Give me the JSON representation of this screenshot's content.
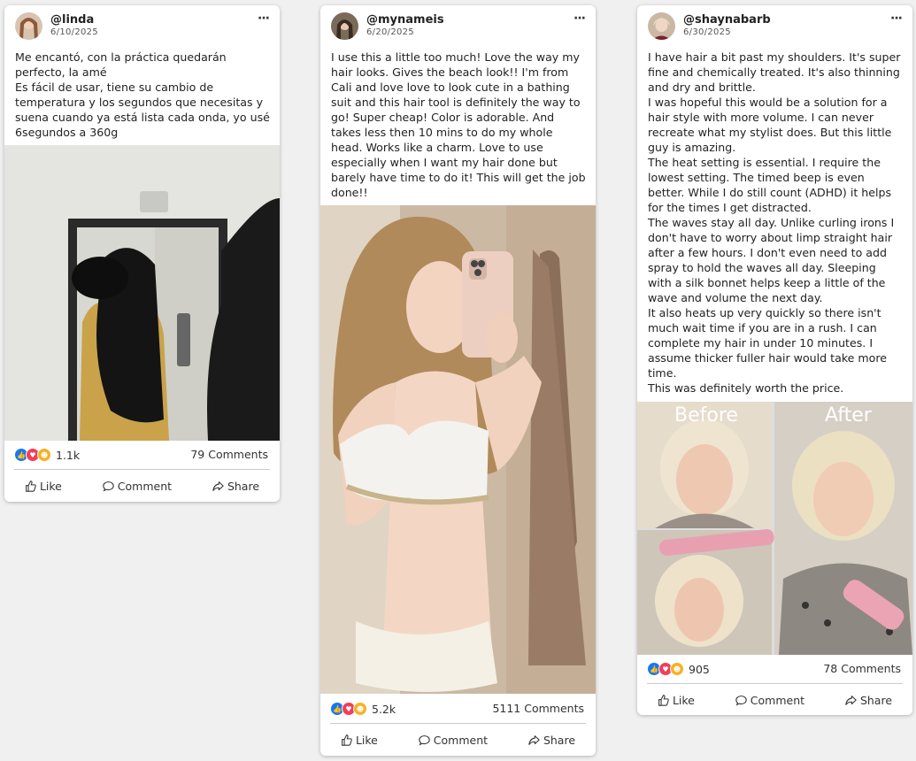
{
  "posts": [
    {
      "username": "@linda",
      "date": "6/10/2025",
      "text": "Me encantó, con la práctica quedarán perfecto, la amé\nEs fácil de usar, tiene su cambio de temperatura y los segundos que necesitas y suena cuando ya está lista cada onda, yo usé 6segundos a 360g",
      "reactions": "1.1k",
      "comments": "79 Comments"
    },
    {
      "username": "@mynameis",
      "date": "6/20/2025",
      "text": "I use this a little too much! Love the way my hair looks. Gives the beach look!! I'm from Cali and love love to look cute in a bathing suit and this hair tool is definitely the way to go! Super cheap! Color is adorable. And takes less then 10 mins to do my whole head. Works like a charm. Love to use especially when I want my hair done but barely have time to do it! This will get the job done!!",
      "reactions": "5.2k",
      "comments": "5111 Comments"
    },
    {
      "username": "@shaynabarb",
      "date": "6/30/2025",
      "text": "I have hair a bit past my shoulders. It's super fine and chemically treated. It's also thinning and dry and brittle.\nI was hopeful this would be a solution for a hair style with more volume. I can never recreate what my stylist does. But this little guy is amazing.\nThe heat setting is essential. I require the lowest setting. The timed beep is even better. While I do still count (ADHD) it helps for the times I get distracted.\nThe waves stay all day. Unlike curling irons I don't have to worry about limp straight hair after a few hours. I don't even need to add spray to hold the waves all day. Sleeping with a silk bonnet helps keep a little of the wave and volume the next day.\nIt also heats up very quickly so there isn't much wait time if you are in a rush. I can complete my hair in under 10 minutes. I assume thicker fuller hair would take more time.\nThis was definitely worth the price.",
      "reactions": "905",
      "comments": "78 Comments",
      "before_label": "Before",
      "after_label": "After"
    }
  ],
  "actions": {
    "like": "Like",
    "comment": "Comment",
    "share": "Share"
  },
  "more_icon": "···"
}
